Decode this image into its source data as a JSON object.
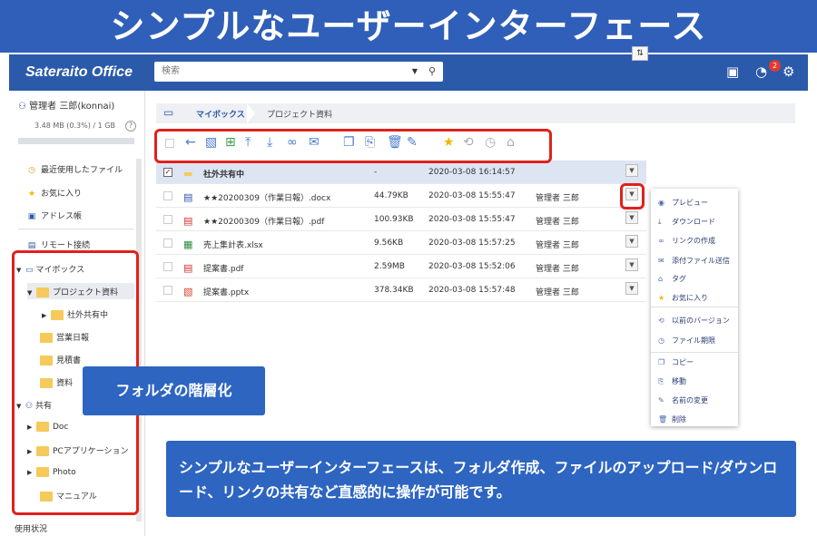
{
  "banner": {
    "title": "シンプルなユーザーインターフェース"
  },
  "header": {
    "logo": "Sateraito Office",
    "search_placeholder": "検索",
    "notification_count": "2"
  },
  "sidebar": {
    "user": "管理者 三郎(konnai)",
    "quota": "3.48 MB (0.3%) / 1 GB",
    "help": "?",
    "nav": [
      {
        "label": "最近使用したファイル",
        "icon": "clock-icon"
      },
      {
        "label": "お気に入り",
        "icon": "star-icon"
      },
      {
        "label": "アドレス帳",
        "icon": "contacts-icon"
      },
      {
        "label": "リモート接続",
        "icon": "remote-icon"
      }
    ],
    "tree": {
      "mybox": "マイボックス",
      "project": "プロジェクト資料",
      "shared_inner": "社外共有中",
      "daily": "営業日報",
      "estimate": "見積書",
      "docs": "資料",
      "shared": "共有",
      "doc": "Doc",
      "pc_app": "PCアプリケーション",
      "photo": "Photo",
      "manual": "マニュアル"
    },
    "footer": "使用状況"
  },
  "breadcrumb": {
    "root": "マイボックス",
    "current": "プロジェクト資料"
  },
  "files": [
    {
      "name": "社外共有中",
      "size": "-",
      "date": "2020-03-08 16:14:57",
      "owner": "",
      "type": "folder"
    },
    {
      "name": "★★20200309（作業日報）.docx",
      "size": "44.79KB",
      "date": "2020-03-08 15:55:47",
      "owner": "管理者 三郎",
      "type": "docx"
    },
    {
      "name": "★★20200309（作業日報）.pdf",
      "size": "100.93KB",
      "date": "2020-03-08 15:55:47",
      "owner": "管理者 三郎",
      "type": "pdf"
    },
    {
      "name": "売上集計表.xlsx",
      "size": "9.56KB",
      "date": "2020-03-08 15:57:25",
      "owner": "管理者 三郎",
      "type": "xlsx"
    },
    {
      "name": "提案書.pdf",
      "size": "2.59MB",
      "date": "2020-03-08 15:52:06",
      "owner": "管理者 三郎",
      "type": "pdf"
    },
    {
      "name": "提案書.pptx",
      "size": "378.34KB",
      "date": "2020-03-08 15:57:48",
      "owner": "管理者 三郎",
      "type": "pptx"
    }
  ],
  "context_menu": [
    {
      "label": "プレビュー",
      "icon": "eye-icon"
    },
    {
      "label": "ダウンロード",
      "icon": "download-icon"
    },
    {
      "label": "リンクの作成",
      "icon": "link-icon"
    },
    {
      "label": "添付ファイル送信",
      "icon": "mail-icon"
    },
    {
      "label": "タグ",
      "icon": "tag-icon"
    },
    {
      "label": "お気に入り",
      "icon": "star-icon"
    },
    {
      "label": "以前のバージョン",
      "icon": "history-icon"
    },
    {
      "label": "ファイル期限",
      "icon": "timer-icon"
    },
    {
      "label": "コピー",
      "icon": "copy-icon"
    },
    {
      "label": "移動",
      "icon": "move-icon"
    },
    {
      "label": "名前の変更",
      "icon": "rename-icon"
    },
    {
      "label": "削除",
      "icon": "trash-icon"
    }
  ],
  "callouts": {
    "hierarchy": "フォルダの階層化",
    "description": "シンプルなユーザーインターフェースは、フォルダ作成、ファイルのアップロード/ダウンロード、リンクの共有など直感的に操作が可能です。"
  },
  "colors": {
    "header": "#2b5aab",
    "banner": "#2f5fb8",
    "highlight_red": "#e0211b",
    "folder": "#f6c95b"
  }
}
